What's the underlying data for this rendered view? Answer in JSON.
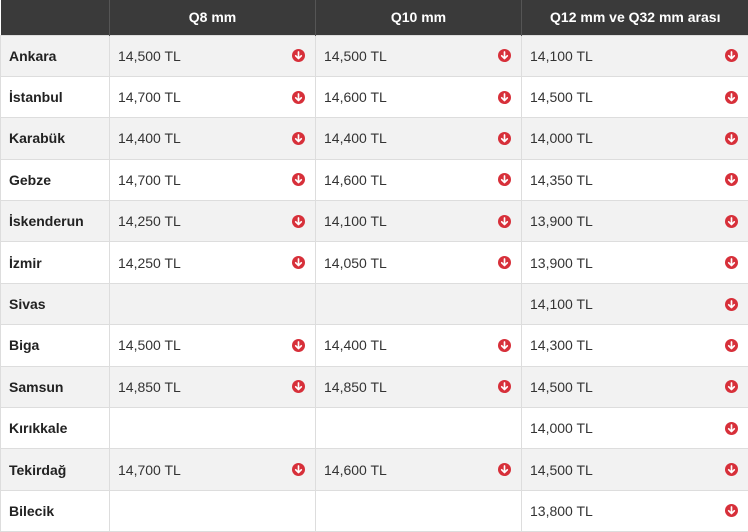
{
  "colors": {
    "header_bg": "#3a3a3a",
    "down_arrow": "#d7303a",
    "row_alt": "#f2f2f2"
  },
  "table": {
    "headers": [
      "",
      "Q8 mm",
      "Q10 mm",
      "Q12 mm ve Q32 mm arası"
    ],
    "rows": [
      {
        "city": "Ankara",
        "cells": [
          {
            "value": "14,500 TL",
            "trend": "down"
          },
          {
            "value": "14,500 TL",
            "trend": "down"
          },
          {
            "value": "14,100 TL",
            "trend": "down"
          }
        ]
      },
      {
        "city": "İstanbul",
        "cells": [
          {
            "value": "14,700 TL",
            "trend": "down"
          },
          {
            "value": "14,600 TL",
            "trend": "down"
          },
          {
            "value": "14,500 TL",
            "trend": "down"
          }
        ]
      },
      {
        "city": "Karabük",
        "cells": [
          {
            "value": "14,400 TL",
            "trend": "down"
          },
          {
            "value": "14,400 TL",
            "trend": "down"
          },
          {
            "value": "14,000 TL",
            "trend": "down"
          }
        ]
      },
      {
        "city": "Gebze",
        "cells": [
          {
            "value": "14,700 TL",
            "trend": "down"
          },
          {
            "value": "14,600 TL",
            "trend": "down"
          },
          {
            "value": "14,350 TL",
            "trend": "down"
          }
        ]
      },
      {
        "city": "İskenderun",
        "cells": [
          {
            "value": "14,250 TL",
            "trend": "down"
          },
          {
            "value": "14,100 TL",
            "trend": "down"
          },
          {
            "value": "13,900 TL",
            "trend": "down"
          }
        ]
      },
      {
        "city": "İzmir",
        "cells": [
          {
            "value": "14,250 TL",
            "trend": "down"
          },
          {
            "value": "14,050 TL",
            "trend": "down"
          },
          {
            "value": "13,900 TL",
            "trend": "down"
          }
        ]
      },
      {
        "city": "Sivas",
        "cells": [
          {
            "value": "",
            "trend": ""
          },
          {
            "value": "",
            "trend": ""
          },
          {
            "value": "14,100 TL",
            "trend": "down"
          }
        ]
      },
      {
        "city": "Biga",
        "cells": [
          {
            "value": "14,500 TL",
            "trend": "down"
          },
          {
            "value": "14,400 TL",
            "trend": "down"
          },
          {
            "value": "14,300 TL",
            "trend": "down"
          }
        ]
      },
      {
        "city": "Samsun",
        "cells": [
          {
            "value": "14,850 TL",
            "trend": "down"
          },
          {
            "value": "14,850 TL",
            "trend": "down"
          },
          {
            "value": "14,500 TL",
            "trend": "down"
          }
        ]
      },
      {
        "city": "Kırıkkale",
        "cells": [
          {
            "value": "",
            "trend": ""
          },
          {
            "value": "",
            "trend": ""
          },
          {
            "value": "14,000 TL",
            "trend": "down"
          }
        ]
      },
      {
        "city": "Tekirdağ",
        "cells": [
          {
            "value": "14,700 TL",
            "trend": "down"
          },
          {
            "value": "14,600 TL",
            "trend": "down"
          },
          {
            "value": "14,500 TL",
            "trend": "down"
          }
        ]
      },
      {
        "city": "Bilecik",
        "cells": [
          {
            "value": "",
            "trend": ""
          },
          {
            "value": "",
            "trend": ""
          },
          {
            "value": "13,800 TL",
            "trend": "down"
          }
        ]
      }
    ]
  }
}
